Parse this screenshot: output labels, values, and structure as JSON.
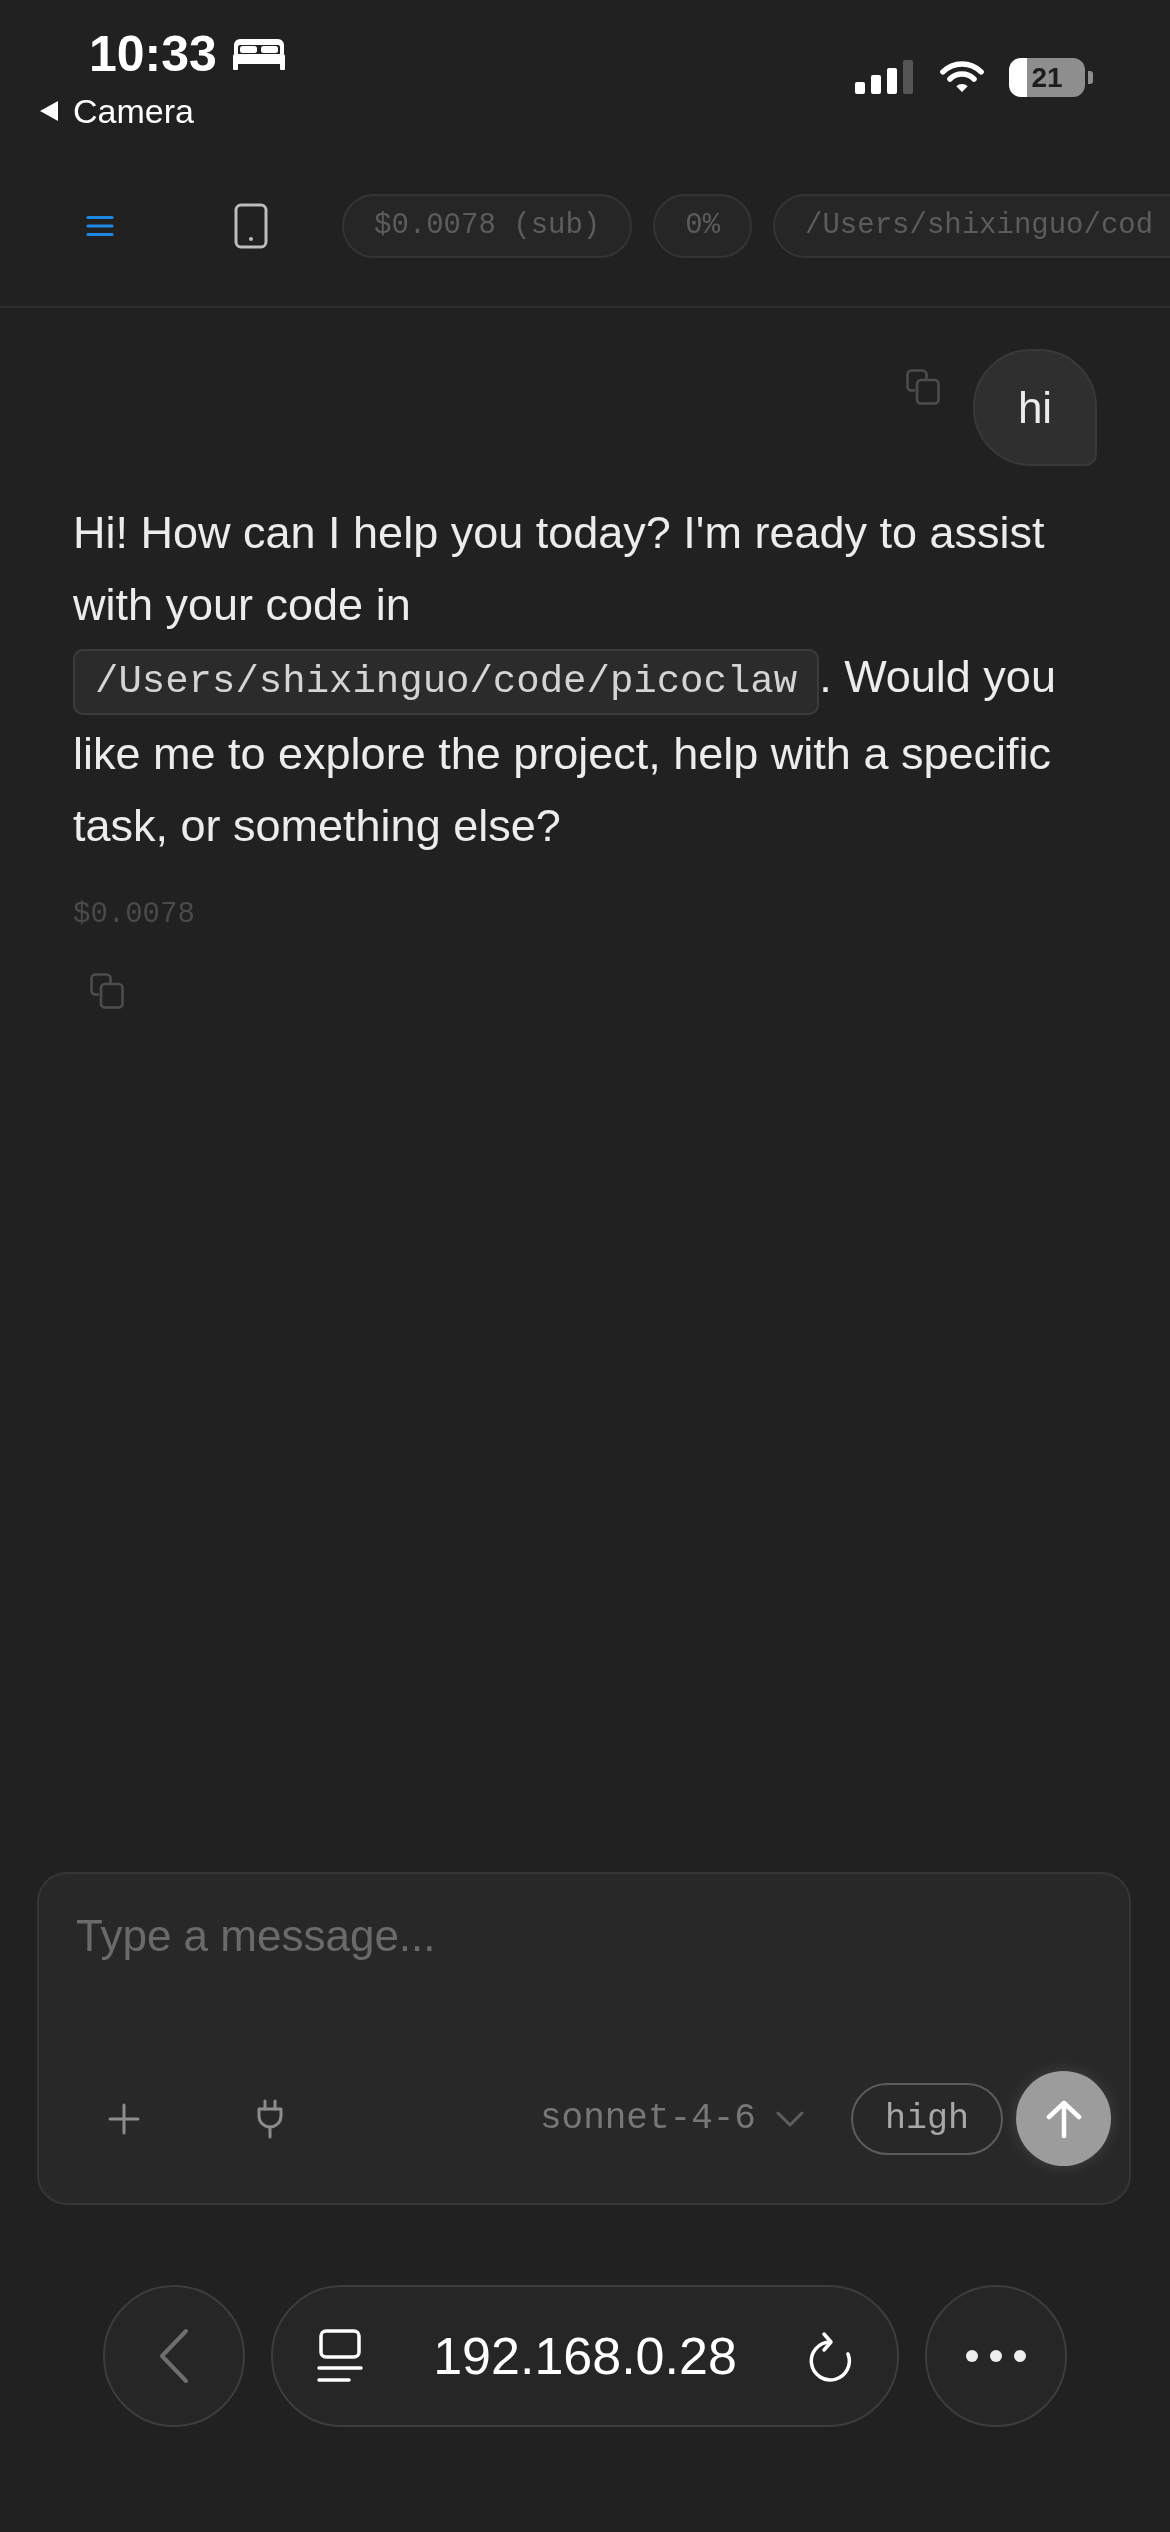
{
  "status_bar": {
    "time": "10:33",
    "back_label": "Camera",
    "battery": "21"
  },
  "toolbar": {
    "pills": [
      {
        "text": "$0.0078 (sub)"
      },
      {
        "text": "0%"
      },
      {
        "text": "/Users/shixinguo/cod"
      }
    ]
  },
  "messages": [
    {
      "kind": "user",
      "text": "hi"
    },
    {
      "kind": "assistant",
      "parts": [
        {
          "kind": "text",
          "text": "Hi! How can I help you today? I'm ready to assist with your code in "
        },
        {
          "kind": "code",
          "text": "/Users/shixinguo/code/picoclaw"
        },
        {
          "kind": "text",
          "text": ". Would you like me to explore the project, help with a specific task, or something else?"
        }
      ],
      "cost": "$0.0078"
    }
  ],
  "composer": {
    "placeholder": "Type a message...",
    "model": "sonnet-4-6",
    "effort": "high"
  },
  "browser_bar": {
    "url": "192.168.0.28"
  }
}
